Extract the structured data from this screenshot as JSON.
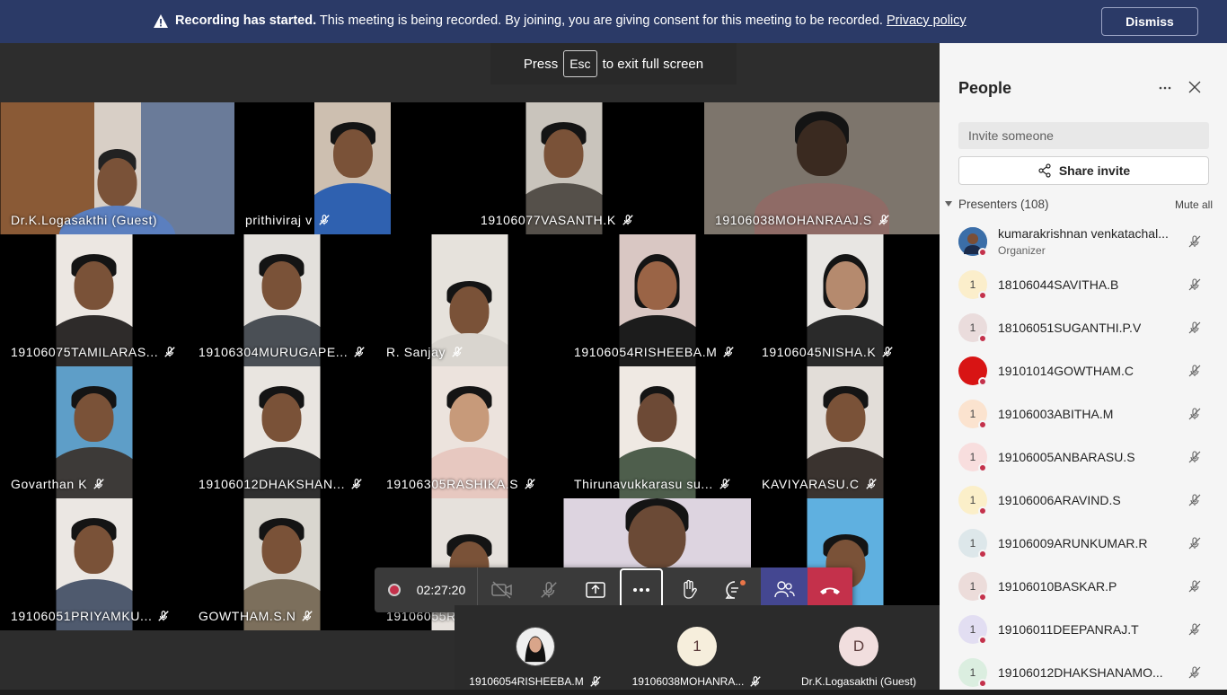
{
  "banner": {
    "title": "Recording has started.",
    "message": " This meeting is being recorded. By joining, you are giving consent for this meeting to be recorded. ",
    "link": "Privacy policy",
    "dismiss": "Dismiss"
  },
  "toast": {
    "pre": "Press",
    "key": "Esc",
    "post": "to exit full screen"
  },
  "tiles": [
    {
      "name": "Dr.K.Logasakthi (Guest)"
    },
    {
      "name": "prithiviraj v"
    },
    {
      "name": "19106077VASANTH.K"
    },
    {
      "name": "19106038MOHANRAAJ.S"
    },
    {
      "name": "19106075TAMILARAS..."
    },
    {
      "name": "19106304MURUGAPE..."
    },
    {
      "name": "R. Sanjay"
    },
    {
      "name": "19106054RISHEEBA.M"
    },
    {
      "name": "19106045NISHA.K"
    },
    {
      "name": "Govarthan K"
    },
    {
      "name": "19106012DHAKSHAN..."
    },
    {
      "name": "19106305RASHIKA.S"
    },
    {
      "name": "Thirunavukkarasu su..."
    },
    {
      "name": "KAVIYARASU.C"
    },
    {
      "name": "19106051PRIYAMKU..."
    },
    {
      "name": "GOWTHAM.S.N"
    },
    {
      "name": "19106055R"
    }
  ],
  "toolbar": {
    "timer": "02:27:20"
  },
  "overflow": [
    {
      "name": "19106054RISHEEBA.M",
      "initial": ""
    },
    {
      "name": "19106038MOHANRA...",
      "initial": "1"
    },
    {
      "name": "Dr.K.Logasakthi (Guest)",
      "initial": "D"
    }
  ],
  "panel": {
    "title": "People",
    "invite_placeholder": "Invite someone",
    "share_invite": "Share invite",
    "section": "Presenters (108)",
    "mute_all": "Mute all",
    "people": [
      {
        "name": "kumarakrishnan venkatachal...",
        "role": "Organizer",
        "initial": "",
        "color": "#3b6ea8"
      },
      {
        "name": "18106044SAVITHA.B",
        "initial": "1",
        "color": "#fbeecb"
      },
      {
        "name": "18106051SUGANTHI.P.V",
        "initial": "1",
        "color": "#eadcdc"
      },
      {
        "name": "19101014GOWTHAM.C",
        "initial": "",
        "color": "#d81414"
      },
      {
        "name": "19106003ABITHA.M",
        "initial": "1",
        "color": "#fbe3cf"
      },
      {
        "name": "19106005ANBARASU.S",
        "initial": "1",
        "color": "#f8dede"
      },
      {
        "name": "19106006ARAVIND.S",
        "initial": "1",
        "color": "#fbefc9"
      },
      {
        "name": "19106009ARUNKUMAR.R",
        "initial": "1",
        "color": "#dde7ea"
      },
      {
        "name": "19106010BASKAR.P",
        "initial": "1",
        "color": "#ecdcda"
      },
      {
        "name": "19106011DEEPANRAJ.T",
        "initial": "1",
        "color": "#e2def2"
      },
      {
        "name": "19106012DHAKSHANAMO...",
        "initial": "1",
        "color": "#dbeee0"
      }
    ]
  }
}
